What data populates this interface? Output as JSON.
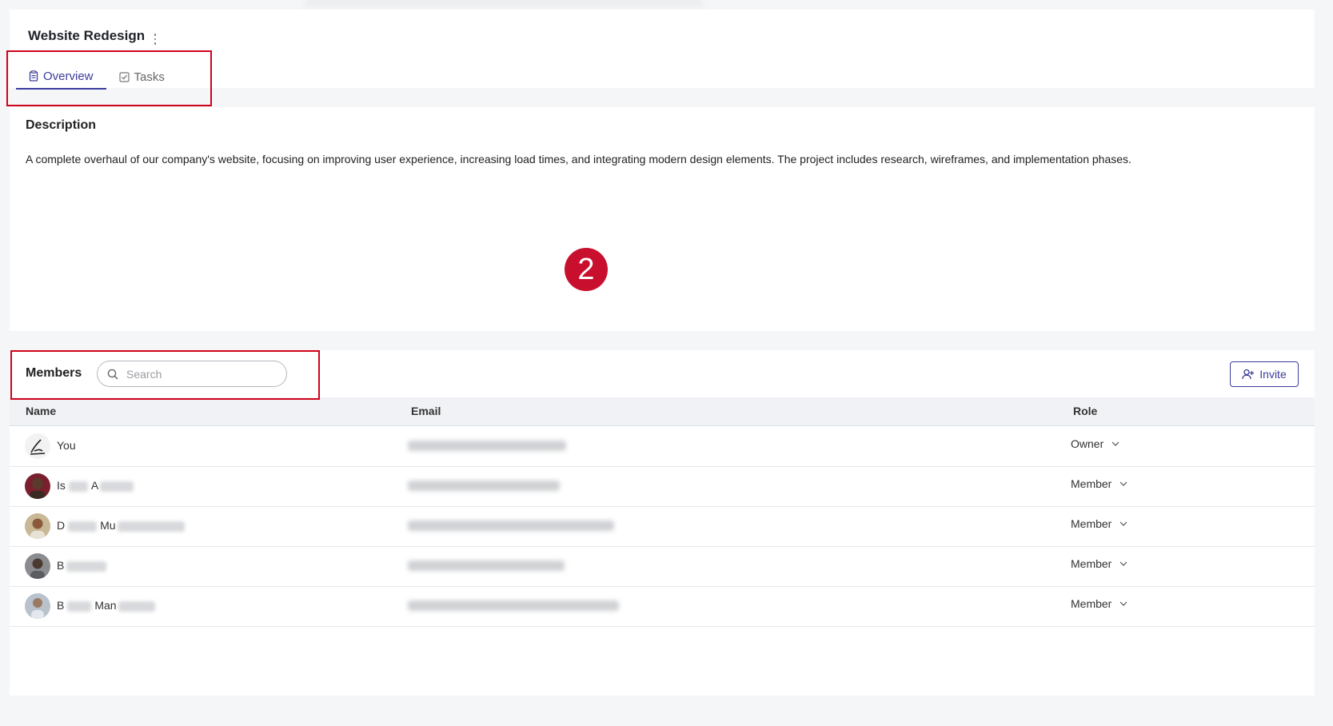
{
  "project": {
    "title": "Website Redesign",
    "more_icon": "kebab-vertical-icon"
  },
  "tabs": [
    {
      "label": "Overview",
      "icon": "clipboard-icon",
      "active": true
    },
    {
      "label": "Tasks",
      "icon": "checkbox-icon",
      "active": false
    }
  ],
  "description": {
    "title": "Description",
    "text": "A complete overhaul of our company's website, focusing on improving user experience, increasing load times, and integrating modern design elements. The project includes research, wireframes, and implementation phases."
  },
  "annotation": {
    "step": "2",
    "color": "#c8102e"
  },
  "members": {
    "title": "Members",
    "search_placeholder": "Search",
    "invite_label": "Invite",
    "columns": {
      "name": "Name",
      "email": "Email",
      "role": "Role"
    },
    "rows": [
      {
        "name_visible": "You",
        "name_hidden": "",
        "name_visible2": "",
        "role": "Owner"
      },
      {
        "name_visible": "Is",
        "name_hidden": "",
        "name_visible2": "A",
        "role": "Member"
      },
      {
        "name_visible": "D",
        "name_hidden": "",
        "name_visible2": "Mu",
        "role": "Member"
      },
      {
        "name_visible": "B",
        "name_hidden": "",
        "name_visible2": "",
        "role": "Member"
      },
      {
        "name_visible": "B",
        "name_hidden": "",
        "name_visible2": "Man",
        "role": "Member"
      }
    ]
  },
  "colors": {
    "accent": "#3b3b9c",
    "highlight": "#d0021b",
    "background": "#f5f6f8"
  }
}
